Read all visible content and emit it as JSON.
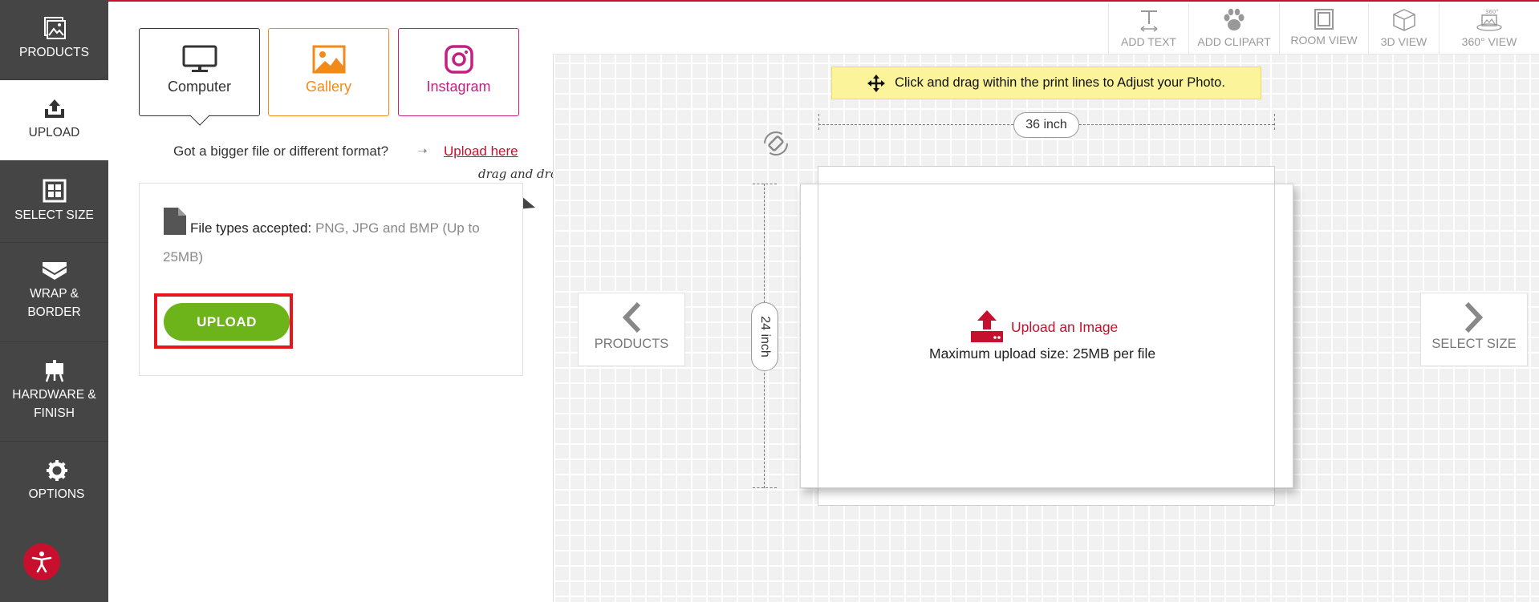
{
  "leftnav": {
    "items": [
      {
        "label": "PRODUCTS",
        "icon": "image-frame-icon"
      },
      {
        "label": "UPLOAD",
        "icon": "upload-tray-icon"
      },
      {
        "label": "SELECT SIZE",
        "icon": "grid-icon"
      },
      {
        "label": "WRAP &",
        "label2": "BORDER",
        "icon": "wrap-icon"
      },
      {
        "label": "HARDWARE &",
        "label2": "FINISH",
        "icon": "easel-icon"
      },
      {
        "label": "OPTIONS",
        "icon": "gear-icon"
      }
    ],
    "active": "UPLOAD"
  },
  "upload_panel": {
    "tabs": [
      {
        "label": "Computer",
        "icon": "monitor-icon",
        "color": "#333333"
      },
      {
        "label": "Gallery",
        "icon": "gallery-icon",
        "color": "#f28a1a"
      },
      {
        "label": "Instagram",
        "icon": "instagram-icon",
        "color": "#c3207f"
      }
    ],
    "bigger_file_text": "Got a bigger file or different format?",
    "upload_here_link": "Upload here",
    "drag_and_drop": "drag and drop",
    "file_types_label": "File types accepted:",
    "file_types_value": "PNG, JPG and BMP (Up to 25MB)",
    "upload_button": "UPLOAD"
  },
  "toolbar": {
    "tools": [
      {
        "label": "ADD TEXT",
        "icon": "text-icon"
      },
      {
        "label": "ADD CLIPART",
        "icon": "paw-icon"
      },
      {
        "label": "ROOM VIEW",
        "icon": "frame-icon"
      },
      {
        "label": "3D VIEW",
        "icon": "cube-icon"
      },
      {
        "label": "360° VIEW",
        "icon": "rotate-360-icon"
      }
    ]
  },
  "canvas": {
    "hint": "Click and drag within the print lines to Adjust your Photo.",
    "width_label": "36 inch",
    "height_label": "24 inch",
    "upload_image_label": "Upload an Image",
    "max_upload": "Maximum upload size: 25MB per file",
    "prev_label": "PRODUCTS",
    "next_label": "SELECT SIZE"
  },
  "colors": {
    "accent_red": "#c5102e",
    "upload_green": "#6db31a",
    "highlight_red": "#e8141e",
    "nav_bg": "#454545",
    "hint_yellow": "#fcf49a"
  }
}
